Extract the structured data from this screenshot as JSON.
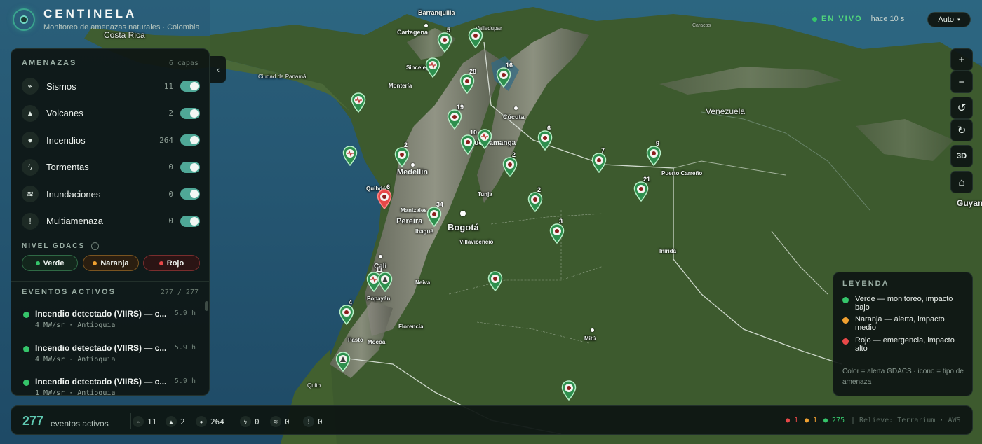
{
  "app": {
    "title": "CENTINELA",
    "subtitle": "Monitoreo de amenazas naturales · Colombia"
  },
  "status": {
    "live_label": "EN VIVO",
    "updated": "hace 10 s",
    "mode": "Auto"
  },
  "colors": {
    "accent": "#4fa897",
    "verde": "#35c46a",
    "naranja": "#f0a030",
    "rojo": "#e84848"
  },
  "threats": {
    "title": "AMENAZAS",
    "count_label": "6 capas",
    "items": [
      {
        "icon": "seismic-wave-icon",
        "label": "Sismos",
        "count": "11",
        "enabled": true
      },
      {
        "icon": "volcano-icon",
        "label": "Volcanes",
        "count": "2",
        "enabled": true
      },
      {
        "icon": "flame-icon",
        "label": "Incendios",
        "count": "264",
        "enabled": true
      },
      {
        "icon": "lightning-icon",
        "label": "Tormentas",
        "count": "0",
        "enabled": true
      },
      {
        "icon": "waves-icon",
        "label": "Inundaciones",
        "count": "0",
        "enabled": true
      },
      {
        "icon": "exclamation-icon",
        "label": "Multiamenaza",
        "count": "0",
        "enabled": true
      }
    ]
  },
  "gdacs": {
    "title": "NIVEL GDACS",
    "levels": [
      {
        "label": "Verde"
      },
      {
        "label": "Naranja"
      },
      {
        "label": "Rojo"
      }
    ]
  },
  "events": {
    "title": "EVENTOS ACTIVOS",
    "count_label": "277 / 277",
    "items": [
      {
        "title": "Incendio detectado (VIIRS) — c...",
        "time": "5.9 h",
        "detail": "4 MW/sr · Antioquia",
        "level": "verde"
      },
      {
        "title": "Incendio detectado (VIIRS) — c...",
        "time": "5.9 h",
        "detail": "4 MW/sr · Antioquia",
        "level": "verde"
      },
      {
        "title": "Incendio detectado (VIIRS) — c...",
        "time": "5.9 h",
        "detail": "1 MW/sr · Antioquia",
        "level": "verde"
      }
    ]
  },
  "map": {
    "places": {
      "barranquilla": "Barranquilla",
      "cartagena": "Cartagena",
      "valledupar": "Valledupar",
      "costa_rica": "Costa Rica",
      "sincelejo": "Sincelejo",
      "monteria": "Montería",
      "ciudad_panama": "Ciudad de Panamá",
      "cucuta": "Cúcuta",
      "bucaramanga": "Bucaramanga",
      "venezuela": "Venezuela",
      "medellin": "Medellín",
      "quibdo": "Quibdó",
      "tunja": "Tunja",
      "puerto_carreno": "Puerto Carreño",
      "manizales": "Manizales",
      "pereira": "Pereira",
      "ibague": "Ibagué",
      "bogota": "Bogotá",
      "villavicencio": "Villavicencio",
      "inirida": "Inírida",
      "cali": "Cali",
      "neiva": "Neiva",
      "popayan": "Popayán",
      "florencia": "Florencia",
      "pasto": "Pasto",
      "mocoa": "Mocoa",
      "mitu": "Mitú",
      "quito": "Quito",
      "guyana": "Guyan",
      "caracas": "Caracas"
    },
    "pin_counts": [
      "5",
      "28",
      "16",
      "19",
      "10",
      "2",
      "6",
      "2",
      "7",
      "9",
      "2",
      "6",
      "21",
      "34",
      "2",
      "3",
      "11",
      "4"
    ]
  },
  "controls": {
    "zoom_in": "+",
    "zoom_out": "−",
    "rotate_left": "↺",
    "rotate_right": "↻",
    "view3d": "3D",
    "home": "⌂"
  },
  "legend": {
    "title": "LEYENDA",
    "items": [
      {
        "label": "Verde — monitoreo, impacto bajo"
      },
      {
        "label": "Naranja — alerta, impacto medio"
      },
      {
        "label": "Rojo — emergencia, impacto alto"
      }
    ],
    "note": "Color = alerta GDACS · icono = tipo de amenaza"
  },
  "footer": {
    "total": "277",
    "total_label": "eventos activos",
    "stats": [
      {
        "icon": "seismic-wave-icon",
        "value": "11"
      },
      {
        "icon": "volcano-icon",
        "value": "2"
      },
      {
        "icon": "flame-icon",
        "value": "264"
      },
      {
        "icon": "lightning-icon",
        "value": "0"
      },
      {
        "icon": "waves-icon",
        "value": "0"
      },
      {
        "icon": "exclamation-icon",
        "value": "0"
      }
    ],
    "count_red": "● 1",
    "count_orange": "● 1",
    "count_green": "● 275",
    "relief": "|  Relieve: Terrarium · AWS"
  }
}
